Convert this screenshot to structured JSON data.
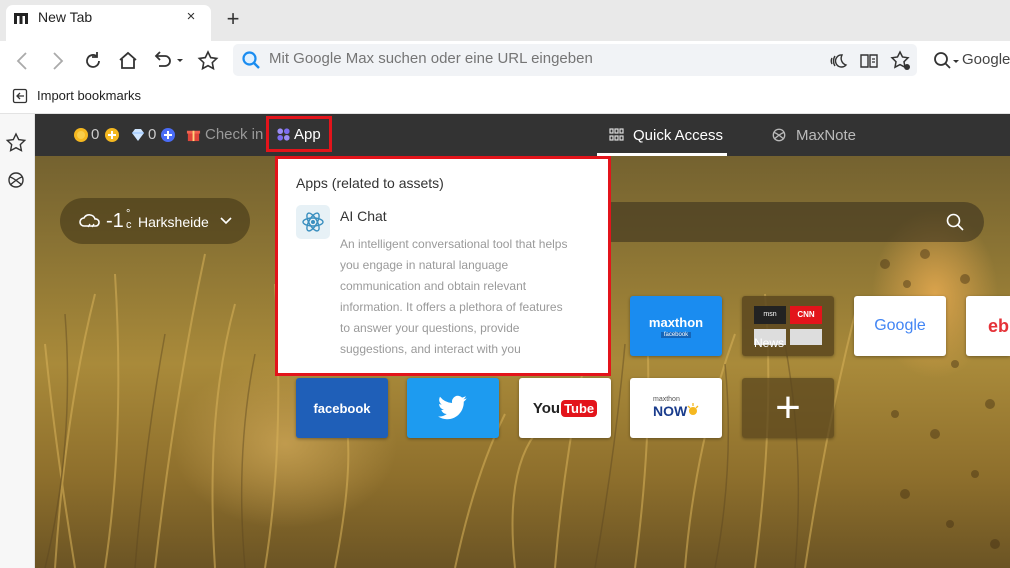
{
  "tab": {
    "title": "New Tab",
    "close": "×",
    "new_tab": "+"
  },
  "nav": {
    "address_placeholder": "Mit Google Max suchen oder eine URL eingeben",
    "right_search_label": "Google"
  },
  "bookmarks_bar": {
    "import_label": "Import bookmarks"
  },
  "topbar": {
    "coins": "0",
    "diamonds": "0",
    "check_in": "Check in",
    "app": "App",
    "quick_access": "Quick Access",
    "maxnote": "MaxNote"
  },
  "weather": {
    "temp": "-1",
    "degree": "°",
    "unit": "c",
    "location": "Harksheide"
  },
  "app_popup": {
    "heading": "Apps (related to assets)",
    "item_title": "AI Chat",
    "item_lines": [
      "An intelligent conversational tool that helps",
      "you engage in natural language",
      "communication and obtain relevant",
      "information. It offers a plethora of features",
      "to answer your questions, provide",
      "suggestions, and interact with you"
    ]
  },
  "tiles": {
    "maxthon": "maxthon",
    "maxthon_sub": "facebook",
    "news": "News",
    "news_msn": "msn",
    "news_cnn": "CNN",
    "google": "Google",
    "ebay": "eb",
    "facebook": "facebook",
    "youtube_you": "You",
    "youtube_tube": "Tube",
    "maxthon_now_top": "maxthon",
    "maxthon_now": "NOW",
    "add": "+"
  },
  "colors": {
    "highlight": "#e3141b",
    "topbar": "#333333",
    "maxthon_blue": "#1a8cf0",
    "twitter_blue": "#1d9bf0"
  },
  "icons": [
    "back-icon",
    "forward-icon",
    "reload-icon",
    "home-icon",
    "undo-icon",
    "favorite-icon",
    "search-icon",
    "read-aloud-icon",
    "reader-icon",
    "favorites-settings-icon",
    "import-icon",
    "sidebar-star-icon",
    "sidebar-maxnote-icon",
    "coin-icon",
    "diamond-icon",
    "gift-icon",
    "app-icon",
    "grid-icon",
    "maxnote-icon",
    "cloud-icon",
    "chevron-down-icon",
    "ai-chat-icon",
    "twitter-icon"
  ]
}
